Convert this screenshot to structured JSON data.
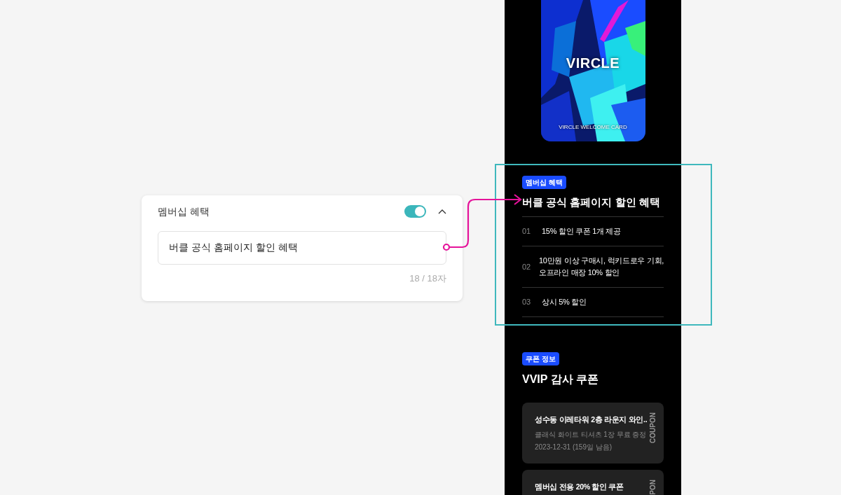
{
  "editor": {
    "label": "멤버십 혜택",
    "enabled": true,
    "expanded": true,
    "value": "버클 공식 홈페이지 할인 혜택",
    "counter": "18 / 18자"
  },
  "preview": {
    "card": {
      "kind": "picture",
      "brand": "VIRCLE",
      "caption": "VIRCLE WELCOME CARD"
    },
    "membership": {
      "badge": "멤버십 혜택",
      "title": "버클 공식 홈페이지 할인 혜택",
      "highlighted": true,
      "items": [
        {
          "number": "01",
          "lines": [
            "15% 할인 쿠폰 1개 제공"
          ]
        },
        {
          "number": "02",
          "lines": [
            "10만원 이상 구매시, 럭키드로우 기회,",
            "오프라인 매장 10% 할인"
          ]
        },
        {
          "number": "03",
          "lines": [
            "상시 5% 할인"
          ]
        }
      ]
    },
    "coupons": {
      "badge": "쿠폰 정보",
      "title": "VVIP 감사 쿠폰",
      "items": [
        {
          "title": "성수동 이레타워 2층 라운지 와인..",
          "description": "클래식 화이트 티셔츠 1장 무료 증정",
          "expiry": "2023-12-31 (159일 남음)",
          "tag": "COUPON"
        },
        {
          "title": "멤버십 전용 20% 할인 쿠폰",
          "tag": "PON"
        }
      ]
    }
  }
}
